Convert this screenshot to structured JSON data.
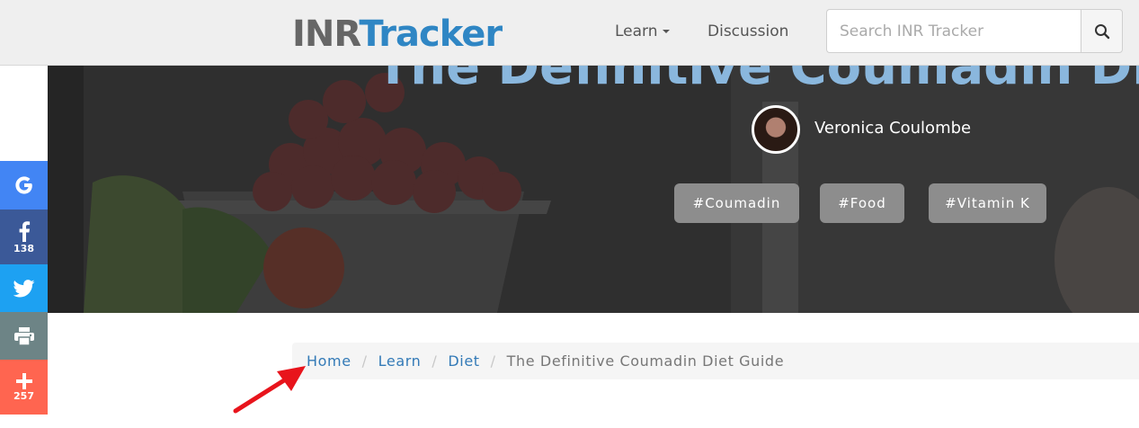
{
  "navbar": {
    "logo_part1": "INR",
    "logo_part2": "Tracker",
    "learn_label": "Learn",
    "discussion_label": "Discussion",
    "search_placeholder": "Search INR Tracker"
  },
  "hero": {
    "title": "The Definitive Coumadin Diet Guide",
    "author": "Veronica Coulombe",
    "tags": [
      "#Coumadin",
      "#Food",
      "#Vitamin K"
    ]
  },
  "social": {
    "facebook_count": "138",
    "more_count": "257"
  },
  "breadcrumb": {
    "items": [
      "Home",
      "Learn",
      "Diet"
    ],
    "current": "The Definitive Coumadin Diet Guide",
    "separator": "/"
  },
  "colors": {
    "brand_blue": "#2f86c4",
    "logo_gray": "#666666",
    "google": "#4285f4",
    "facebook": "#3b5998",
    "twitter": "#1da1f2",
    "print": "#6d8486",
    "more": "#ff6550",
    "arrow": "#e8141c"
  },
  "icons": {
    "search": "search-icon",
    "google": "google-icon",
    "facebook": "facebook-icon",
    "twitter": "twitter-icon",
    "print": "print-icon",
    "more": "plus-icon",
    "annotation": "red-arrow-icon"
  }
}
